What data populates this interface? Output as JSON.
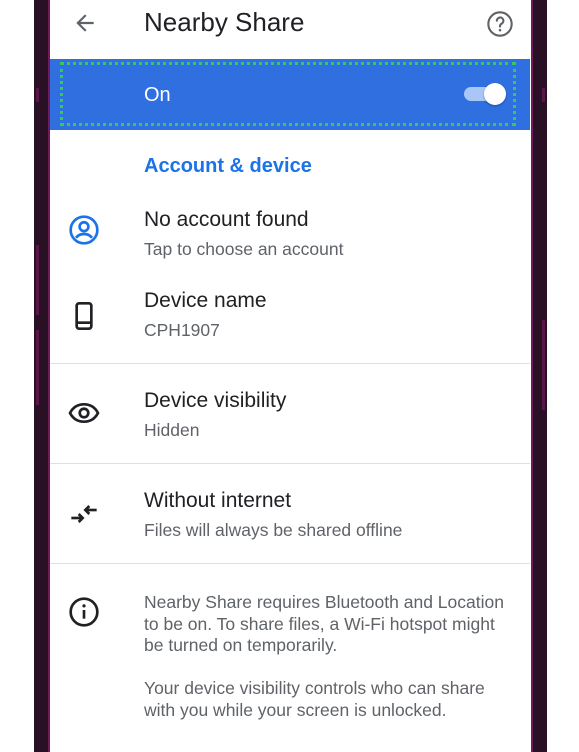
{
  "appbar": {
    "title": "Nearby Share",
    "back_icon": "arrow-back-icon",
    "help_icon": "help-circle-icon"
  },
  "main_toggle": {
    "label": "On",
    "state": "on",
    "bar_color": "#2f6fe0"
  },
  "section": {
    "title": "Account & device",
    "accent_color": "#1a73e8"
  },
  "settings": [
    {
      "icon": "account-circle-icon",
      "primary": "No account found",
      "secondary": "Tap to choose an account"
    },
    {
      "icon": "phone-icon",
      "primary": "Device name",
      "secondary": "CPH1907"
    },
    {
      "icon": "eye-icon",
      "primary": "Device visibility",
      "secondary": "Hidden"
    },
    {
      "icon": "offline-arrows-icon",
      "primary": "Without internet",
      "secondary": "Files will always be shared offline"
    }
  ],
  "info": {
    "icon": "info-icon",
    "paragraph_1": "Nearby Share requires Bluetooth and Location to be on. To share files, a Wi-Fi hotspot might be turned on temporarily.",
    "paragraph_2": "Your device visibility controls who can share with you while your screen is unlocked."
  }
}
